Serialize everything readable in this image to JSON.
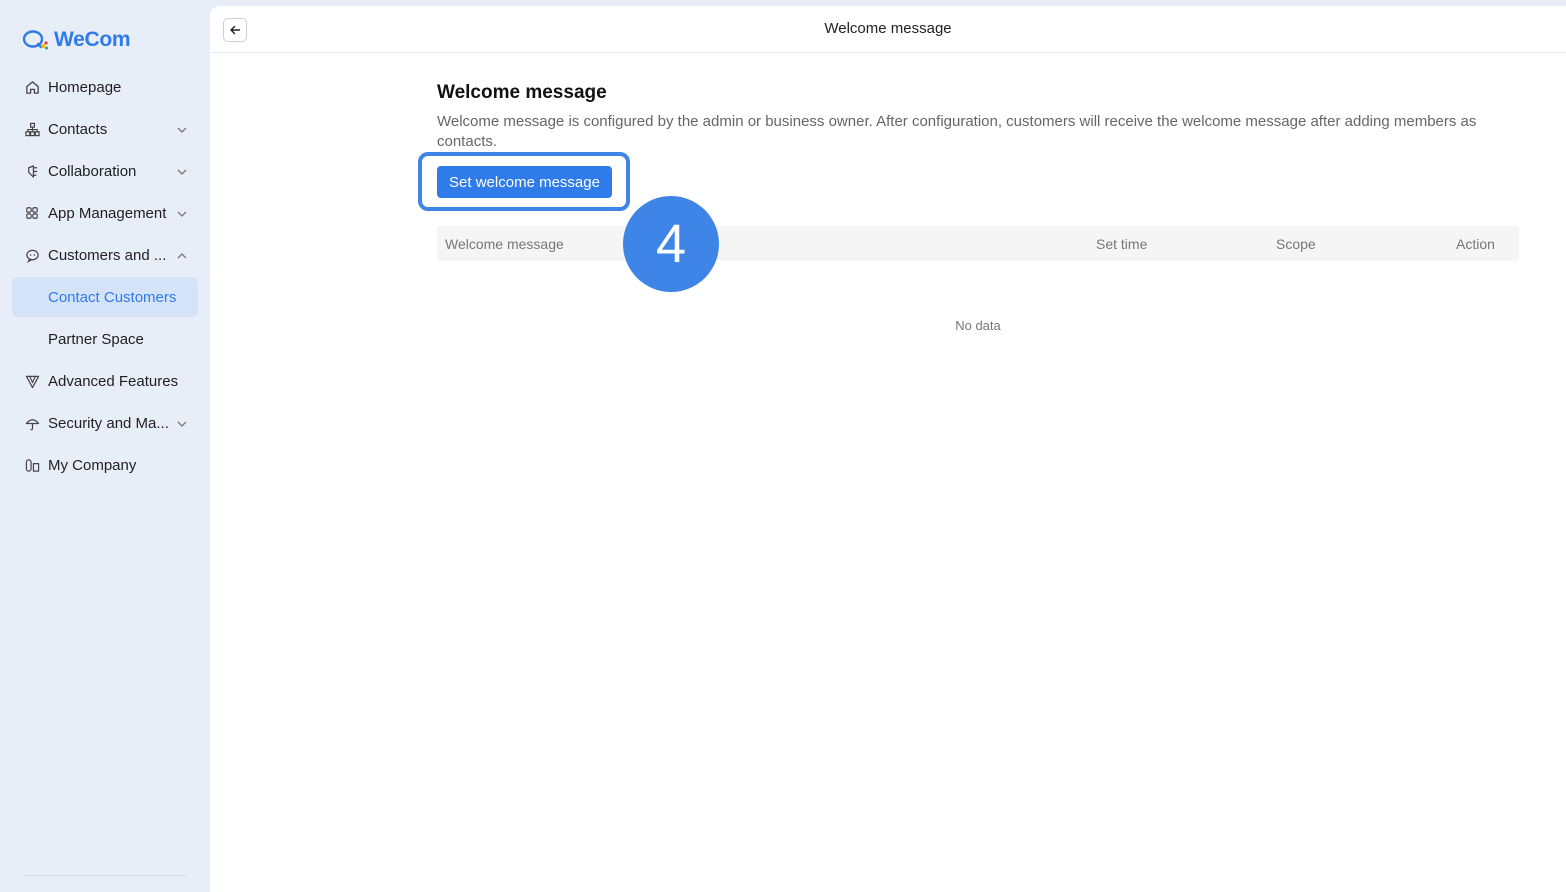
{
  "app": {
    "logo_text": "WeCom"
  },
  "sidebar": {
    "items": [
      {
        "label": "Homepage",
        "icon": "home-icon"
      },
      {
        "label": "Contacts",
        "icon": "org-chart-icon",
        "chevron": "down"
      },
      {
        "label": "Collaboration",
        "icon": "collaboration-icon",
        "chevron": "down"
      },
      {
        "label": "App Management",
        "icon": "apps-grid-icon",
        "chevron": "down"
      },
      {
        "label": "Customers and ...",
        "icon": "chat-bubble-icon",
        "chevron": "up"
      },
      {
        "label": "Contact Customers",
        "active": true
      },
      {
        "label": "Partner Space"
      },
      {
        "label": "Advanced Features",
        "icon": "advanced-features-icon"
      },
      {
        "label": "Security and Ma...",
        "icon": "umbrella-icon",
        "chevron": "down"
      },
      {
        "label": "My Company",
        "icon": "company-icon"
      }
    ]
  },
  "topbar": {
    "title": "Welcome message"
  },
  "main": {
    "title": "Welcome message",
    "description": "Welcome message is configured by the admin or business owner. After configuration, customers will receive the welcome message after adding members as contacts.",
    "primary_button": "Set welcome message",
    "step_number": "4",
    "table": {
      "columns": [
        "Welcome message",
        "Set time",
        "Scope",
        "Action"
      ],
      "empty_text": "No data"
    }
  },
  "colors": {
    "accent": "#2f7bea",
    "highlight": "#3e85e7",
    "sidebar_bg": "#e8eef8"
  }
}
